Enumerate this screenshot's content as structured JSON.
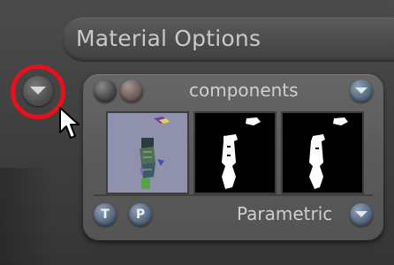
{
  "header": {
    "title": "Material Options"
  },
  "panel": {
    "title": "components",
    "footer_label": "Parametric",
    "left_buttons": [
      {
        "label": "T"
      },
      {
        "label": "P"
      }
    ],
    "thumbnails": [
      {
        "name": "material-preview"
      },
      {
        "name": "texture-map"
      },
      {
        "name": "texture-map-alt"
      }
    ]
  },
  "colors": {
    "highlight_ring": "#e8101c",
    "panel": "#5f5f5f",
    "text": "#cfcfcf"
  },
  "icons": [
    "chevron-down-icon",
    "cursor-arrow-icon"
  ]
}
